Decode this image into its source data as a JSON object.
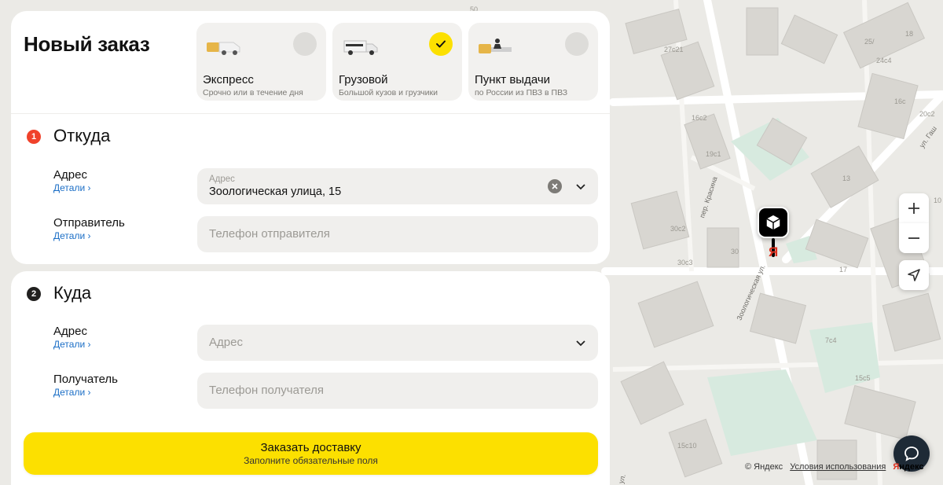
{
  "order": {
    "title": "Новый заказ",
    "delivery_types": [
      {
        "title": "Экспресс",
        "subtitle": "Срочно или в течение дня",
        "selected": false
      },
      {
        "title": "Грузовой",
        "subtitle": "Большой кузов и грузчики",
        "selected": true
      },
      {
        "title": "Пункт выдачи",
        "subtitle": "по России из ПВЗ в ПВЗ",
        "selected": false
      }
    ]
  },
  "from": {
    "step": "1",
    "title": "Откуда",
    "address_label": "Адрес",
    "address_details": "Детали",
    "address_field_label": "Адрес",
    "address_value": "Зоологическая улица, 15",
    "sender_label": "Отправитель",
    "sender_details": "Детали",
    "sender_placeholder": "Телефон отправителя"
  },
  "to": {
    "step": "2",
    "title": "Куда",
    "address_label": "Адрес",
    "address_details": "Детали",
    "address_placeholder": "Адрес",
    "recipient_label": "Получатель",
    "recipient_details": "Детали",
    "recipient_placeholder": "Телефон получателя"
  },
  "submit": {
    "label": "Заказать доставку",
    "hint": "Заполните обязательные поля"
  },
  "map": {
    "copyright": "© Яндекс",
    "terms": "Условия использования",
    "logo_y": "Я",
    "logo_rest": "ндекс",
    "marker_letter": "Я",
    "streets": [
      "пер. Красина",
      "Зоологическая ул.",
      "ул. Гаш",
      "ул."
    ],
    "house_numbers": [
      "50",
      "27с21",
      "25/",
      "18",
      "24с4",
      "16с2",
      "19с1",
      "16с",
      "20с2",
      "13",
      "30с2",
      "30",
      "30с3",
      "17",
      "7с4",
      "15с5",
      "15с10",
      "10"
    ]
  },
  "colors": {
    "accent_yellow": "#fce000",
    "step1": "#f0422b",
    "step2": "#21201f",
    "link": "#1b6ec6"
  },
  "icons": [
    "express-car-icon",
    "truck-icon",
    "pickup-point-icon",
    "check-icon",
    "clear-icon",
    "chevron-down-icon",
    "zoom-in-icon",
    "zoom-out-icon",
    "locate-icon",
    "chat-icon",
    "cube-icon"
  ]
}
